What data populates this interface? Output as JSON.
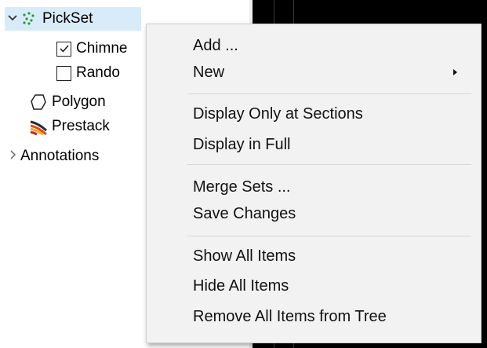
{
  "tree": {
    "items": [
      {
        "label": "PickSet",
        "icon": "pickset-icon",
        "expander": "expanded"
      },
      {
        "label": "Chimne",
        "checked": true
      },
      {
        "label": "Rando",
        "checked": false
      },
      {
        "label": "Polygon",
        "icon": "polygon-icon"
      },
      {
        "label": "Prestack",
        "icon": "prestack-icon"
      },
      {
        "label": "Annotations",
        "expander": "collapsed"
      }
    ]
  },
  "context_menu": {
    "groups": [
      [
        {
          "label": "Add ..."
        },
        {
          "label": "New",
          "submenu": true
        }
      ],
      [
        {
          "label": "Display Only at Sections"
        },
        {
          "label": "Display in Full"
        }
      ],
      [
        {
          "label": "Merge Sets ..."
        },
        {
          "label": "Save Changes"
        }
      ],
      [
        {
          "label": "Show All Items"
        },
        {
          "label": "Hide All Items"
        },
        {
          "label": "Remove All Items from Tree"
        }
      ]
    ]
  },
  "colors": {
    "selection": "#d8ebf9",
    "menu_bg": "#f2f2f2",
    "viewer_bg": "#000000"
  }
}
